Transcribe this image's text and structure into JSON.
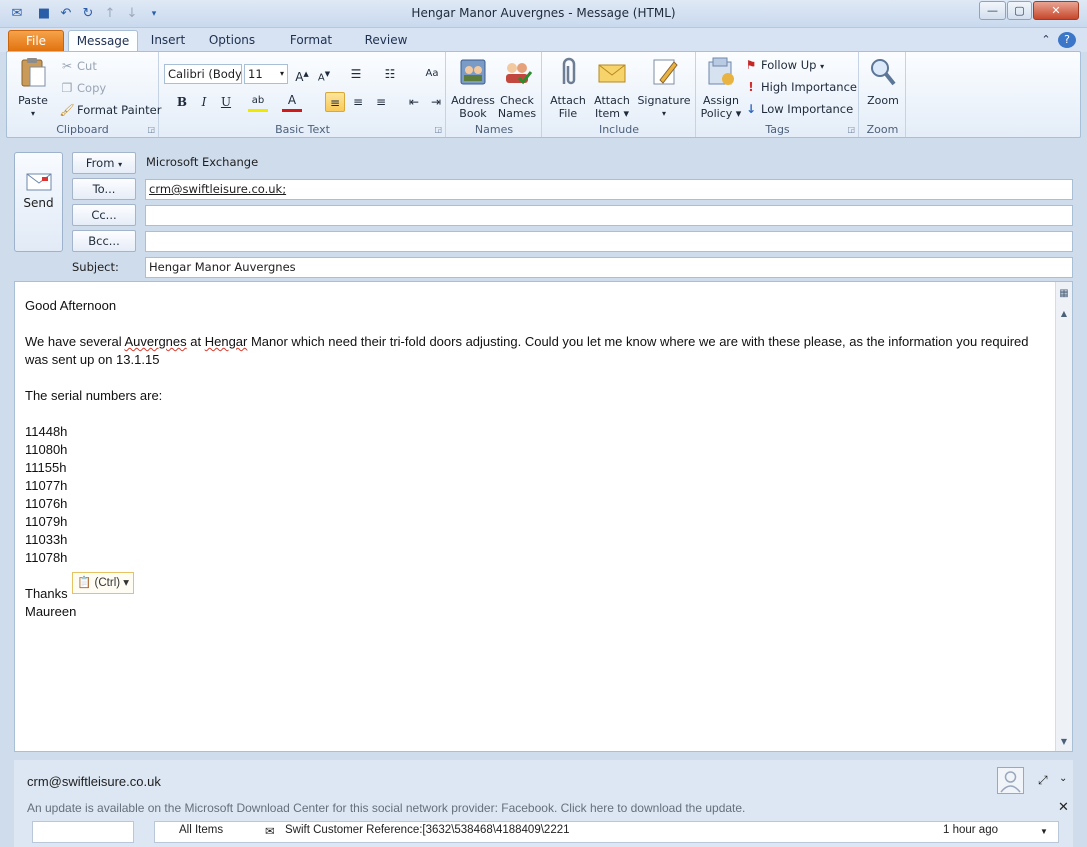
{
  "window": {
    "title": "Hengar Manor Auvergnes  -  Message (HTML)"
  },
  "tabs": [
    "File",
    "Message",
    "Insert",
    "Options",
    "Format Text",
    "Review"
  ],
  "ribbon": {
    "clipboard": {
      "paste": "Paste",
      "cut": "Cut",
      "copy": "Copy",
      "format_painter": "Format Painter",
      "label": "Clipboard"
    },
    "basic_text": {
      "font": "Calibri (Body)",
      "size": "11",
      "label": "Basic Text"
    },
    "names": {
      "address_book": [
        "Address",
        "Book"
      ],
      "check_names": [
        "Check",
        "Names"
      ],
      "label": "Names"
    },
    "include": {
      "attach_file": [
        "Attach",
        "File"
      ],
      "attach_item": [
        "Attach",
        "Item ▾"
      ],
      "signature": "Signature",
      "label": "Include"
    },
    "tags": {
      "assign_policy": [
        "Assign",
        "Policy ▾"
      ],
      "follow_up": "Follow Up",
      "high_importance": "High Importance",
      "low_importance": "Low Importance",
      "label": "Tags"
    },
    "zoom": {
      "zoom": "Zoom",
      "label": "Zoom"
    }
  },
  "header": {
    "send": "Send",
    "from_label": "From",
    "from_value": "Microsoft Exchange",
    "to_label": "To...",
    "to_value": "crm@swiftleisure.co.uk;",
    "cc_label": "Cc...",
    "cc_value": "",
    "bcc_label": "Bcc...",
    "bcc_value": "",
    "subject_label": "Subject:",
    "subject_value": "Hengar Manor Auvergnes"
  },
  "body": {
    "greeting": "Good Afternoon",
    "para_pre": "We have several ",
    "para_w1": "Auvergnes",
    "para_mid": " at ",
    "para_w2": "Hengar",
    "para_post": " Manor which need their tri-fold doors adjusting.  Could you let me know where we are with these please, as the information you required was sent up on 13.1.15",
    "serial_intro": "The serial numbers are:",
    "serials": [
      "11448h",
      "11080h",
      "11155h",
      "11077h",
      "11076h",
      "11079h",
      "11033h",
      "11078h"
    ],
    "thanks": "Thanks",
    "signature": "Maureen",
    "paste_options": "(Ctrl) ▾"
  },
  "people_pane": {
    "email": "crm@swiftleisure.co.uk",
    "update_notice": "An update is available on the Microsoft Download Center for this social network provider: Facebook. Click here to download the update.",
    "all_items": "All Items",
    "item_title": "Swift Customer Reference:[3632\\538468\\4188409\\2221",
    "item_time": "1 hour ago"
  }
}
